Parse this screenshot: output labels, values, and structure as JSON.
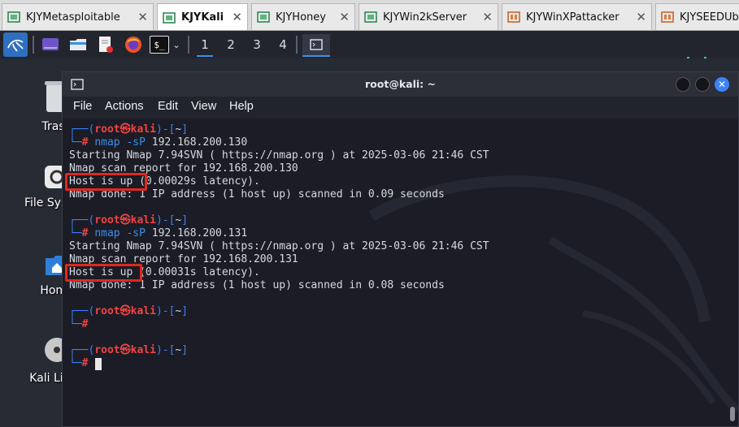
{
  "vm_tabs": [
    {
      "label": "KJYMetasploitable",
      "icon": "vm-icon",
      "active": false
    },
    {
      "label": "KJYKali",
      "icon": "vm-icon",
      "active": true
    },
    {
      "label": "KJYHoney",
      "icon": "vm-icon",
      "active": false
    },
    {
      "label": "KJYWin2kServer",
      "icon": "vm-icon",
      "active": false
    },
    {
      "label": "KJYWinXPattacker",
      "icon": "vm-icon-orange",
      "active": false
    },
    {
      "label": "KJYSEEDUbuntu",
      "icon": "vm-icon-orange",
      "active": false
    }
  ],
  "panel": {
    "workspaces": [
      "1",
      "2",
      "3",
      "4"
    ],
    "icons": [
      "kali-menu-icon",
      "show-desktop-icon",
      "file-manager-icon",
      "text-editor-icon",
      "firefox-icon",
      "terminal-icon",
      "chevron-down-icon",
      "active-terminal-icon"
    ]
  },
  "desktop_icons": [
    {
      "label": "Trash",
      "icon": "trash-icon"
    },
    {
      "label": "File System",
      "icon": "drive-icon"
    },
    {
      "label": "Home",
      "icon": "home-folder-icon"
    },
    {
      "label": "Kali Linux",
      "icon": "disc-icon"
    }
  ],
  "terminal": {
    "title": "root@kali: ~",
    "menu": [
      "File",
      "Actions",
      "Edit",
      "View",
      "Help"
    ],
    "prompt": {
      "open": "┌──(",
      "user": "root㉿kali",
      "close": ")-[",
      "dir": "~",
      "end": "]",
      "corner": "└─",
      "hash": "#"
    },
    "sessions": [
      {
        "command": "nmap",
        "flag": "-sP",
        "target": "192.168.200.130",
        "output": [
          "Starting Nmap 7.94SVN ( https://nmap.org ) at 2025-03-06 21:46 CST",
          "Nmap scan report for 192.168.200.130",
          "Host is up (0.00029s latency).",
          "Nmap done: 1 IP address (1 host up) scanned in 0.09 seconds"
        ]
      },
      {
        "command": "nmap",
        "flag": "-sP",
        "target": "192.168.200.131",
        "output": [
          "Starting Nmap 7.94SVN ( https://nmap.org ) at 2025-03-06 21:46 CST",
          "Nmap scan report for 192.168.200.131",
          "Host is up (0.00031s latency).",
          "Nmap done: 1 IP address (1 host up) scanned in 0.08 seconds"
        ]
      }
    ],
    "empty_prompts": 2
  },
  "colors": {
    "prompt_blue": "#3b82f6",
    "prompt_red": "#ef4444",
    "highlight_box": "#e0281e",
    "terminal_bg": "#1b1c25"
  }
}
